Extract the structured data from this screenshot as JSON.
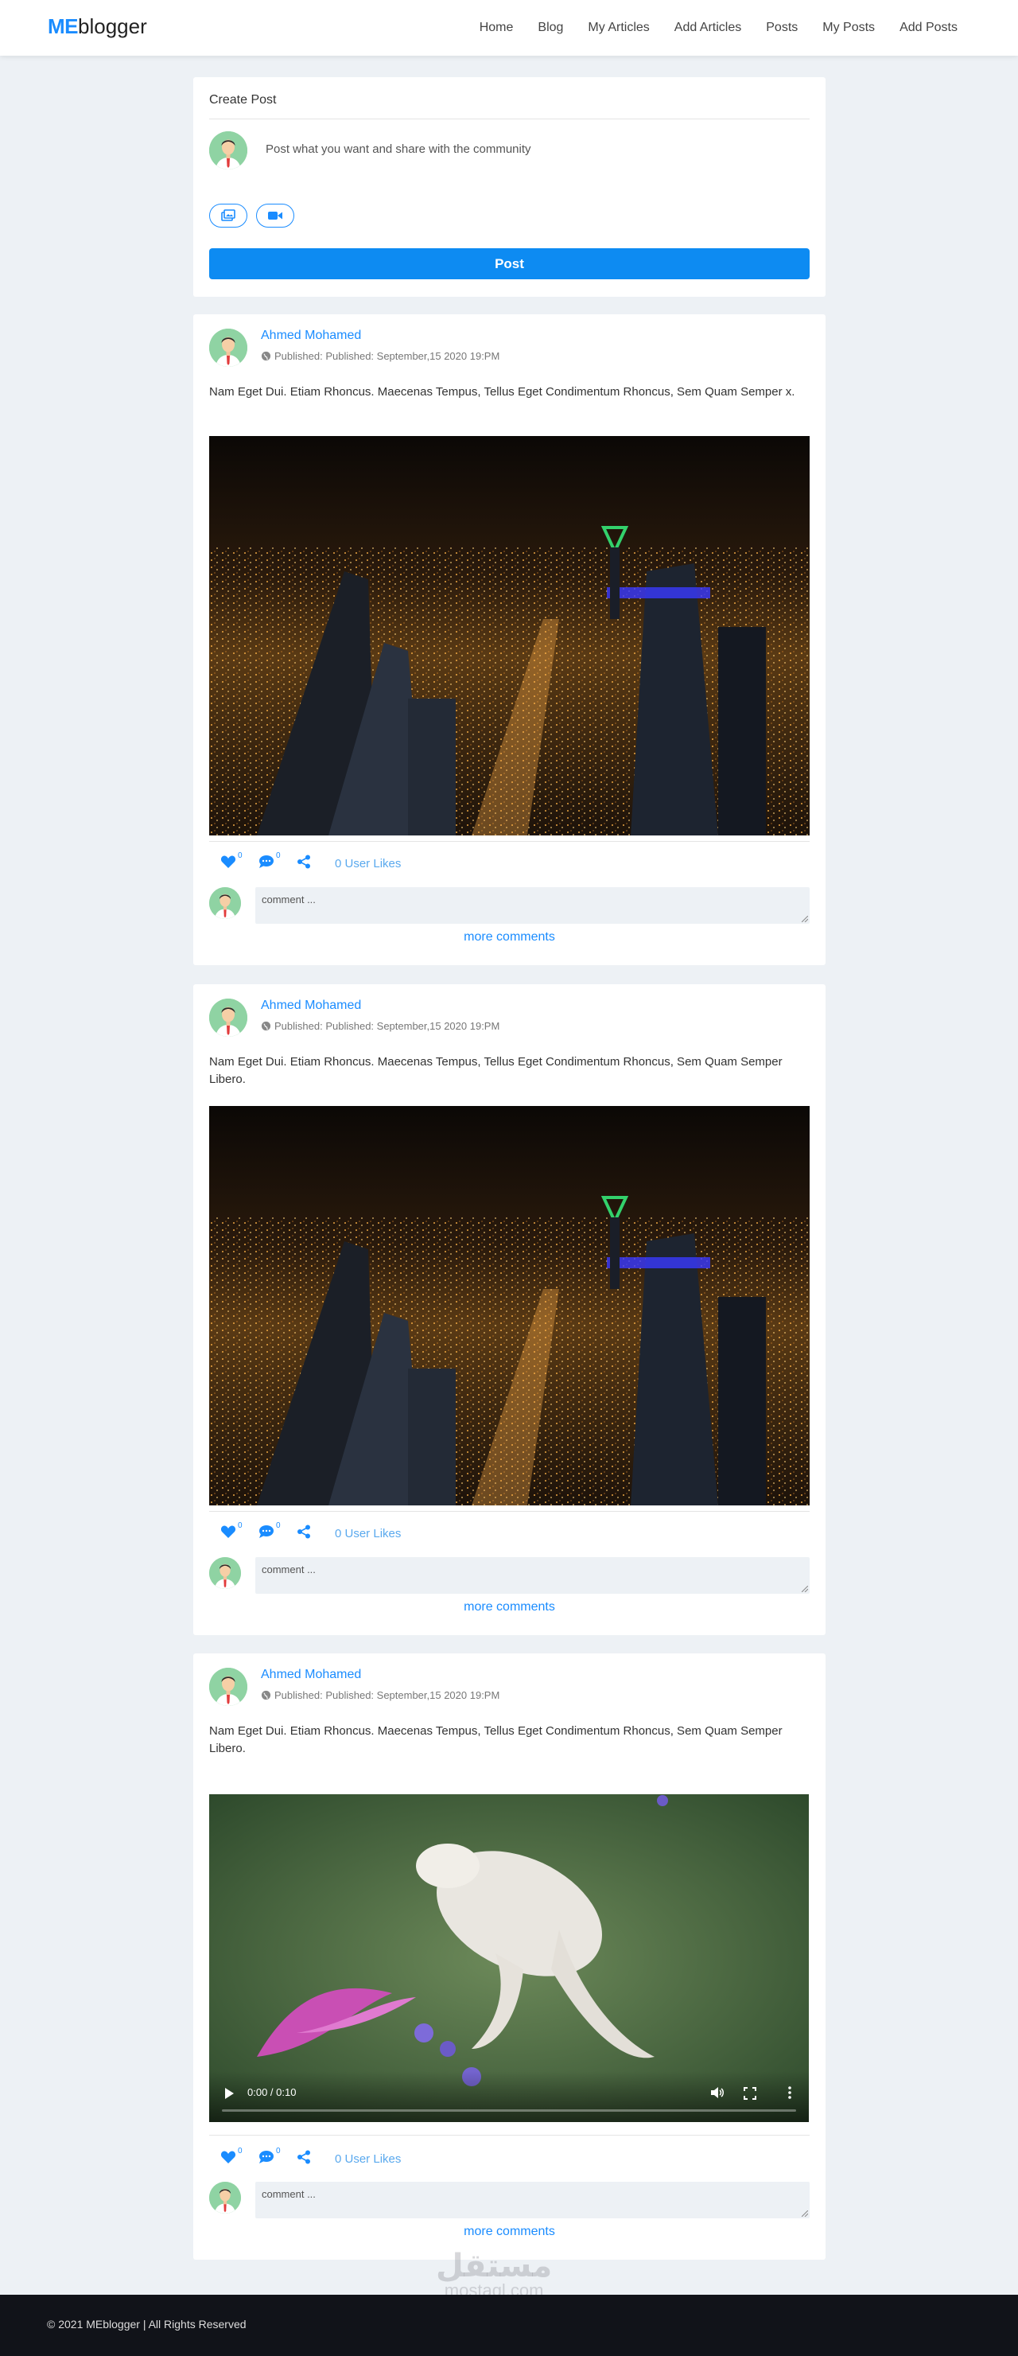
{
  "brand": {
    "prefix": "ME",
    "suffix": "blogger"
  },
  "nav": [
    "Home",
    "Blog",
    "My Articles",
    "Add Articles",
    "Posts",
    "My Posts",
    "Add Posts"
  ],
  "create_post": {
    "title": "Create Post",
    "prompt": "Post what you want and share with the community",
    "photo_icon": "image-icon",
    "video_icon": "video-camera-icon",
    "post_label": "Post"
  },
  "posts": [
    {
      "author": "Ahmed Mohamed",
      "published": "Published: Published: September,15 2020 19:PM",
      "text": "Nam Eget Dui. Etiam Rhoncus. Maecenas Tempus, Tellus Eget Condimentum Rhoncus, Sem Quam Semper x.",
      "media": "night-city-image",
      "like_count": "0",
      "comment_count": "0",
      "likes_label": "0 User Likes",
      "comment_placeholder": "comment ...",
      "more_label": "more comments"
    },
    {
      "author": "Ahmed Mohamed",
      "published": "Published: Published: September,15 2020 19:PM",
      "text": "Nam Eget Dui. Etiam Rhoncus. Maecenas Tempus, Tellus Eget Condimentum Rhoncus, Sem Quam Semper Libero.",
      "media": "night-city-image",
      "like_count": "0",
      "comment_count": "0",
      "likes_label": "0 User Likes",
      "comment_placeholder": "comment ...",
      "more_label": "more comments"
    },
    {
      "author": "Ahmed Mohamed",
      "published": "Published: Published: September,15 2020 19:PM",
      "text": "Nam Eget Dui. Etiam Rhoncus. Maecenas Tempus, Tellus Eget Condimentum Rhoncus, Sem Quam Semper Libero.",
      "media": "video-player",
      "video_time": "0:00 / 0:10",
      "video_progress": 0,
      "like_count": "0",
      "comment_count": "0",
      "likes_label": "0 User Likes",
      "comment_placeholder": "comment ...",
      "more_label": "more comments"
    }
  ],
  "footer": "© 2021 MEblogger | All Rights Reserved",
  "watermark": {
    "arabic": "مستقل",
    "latin": "mostaql.com"
  },
  "colors": {
    "accent": "#1a8cff",
    "post_button": "#0d8bf2",
    "page_bg": "#edf1f5",
    "footer_bg": "#111319"
  }
}
